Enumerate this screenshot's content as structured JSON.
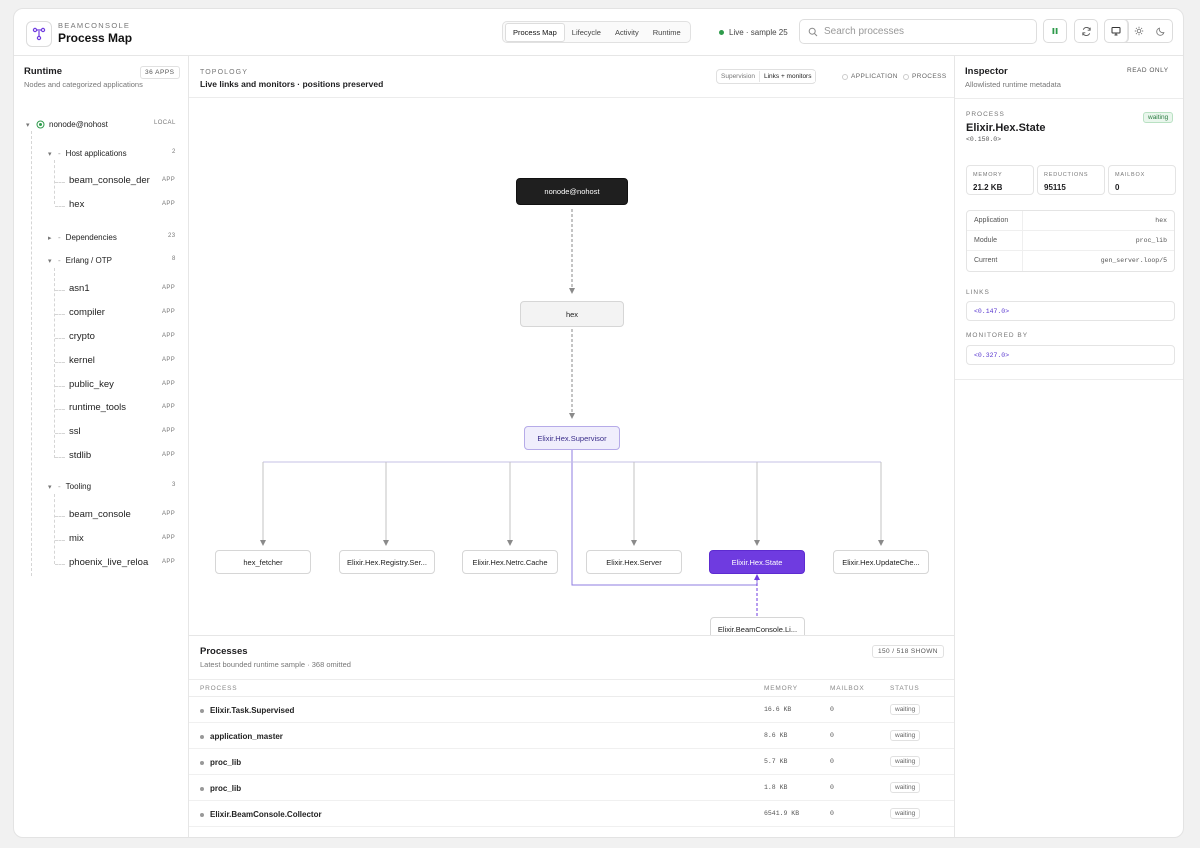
{
  "header": {
    "brand_small": "BEAMCONSOLE",
    "brand_title": "Process Map",
    "tabs": [
      "Process Map",
      "Lifecycle",
      "Activity",
      "Runtime"
    ],
    "live_text": "Live · sample 25",
    "search_placeholder": "Search processes",
    "colors": {
      "live": "#2e9b4b",
      "accent": "#6f3be0"
    }
  },
  "sidebar": {
    "title": "Runtime",
    "subtitle": "Nodes and categorized applications",
    "badge": "36 APPS",
    "node": {
      "name": "nonode@nohost",
      "tag": "LOCAL"
    },
    "groups": [
      {
        "label": "Host applications",
        "count": "2",
        "expanded": true,
        "apps": [
          "beam_console_der",
          "hex"
        ]
      },
      {
        "label": "Dependencies",
        "count": "23",
        "expanded": false,
        "apps": []
      },
      {
        "label": "Erlang / OTP",
        "count": "8",
        "expanded": true,
        "apps": [
          "asn1",
          "compiler",
          "crypto",
          "kernel",
          "public_key",
          "runtime_tools",
          "ssl",
          "stdlib"
        ]
      },
      {
        "label": "Tooling",
        "count": "3",
        "expanded": true,
        "apps": [
          "beam_console",
          "mix",
          "phoenix_live_reloa"
        ]
      }
    ],
    "app_tag": "APP"
  },
  "topology": {
    "kicker": "TOPOLOGY",
    "title": "Live links and monitors · positions preserved",
    "segments": [
      "Supervision",
      "Links + monitors"
    ],
    "legend": [
      "APPLICATION",
      "PROCESS"
    ],
    "nodes": {
      "root": "nonode@nohost",
      "app": "hex",
      "sup": "Elixir.Hex.Supervisor",
      "children": [
        "hex_fetcher",
        "Elixir.Hex.Registry.Ser...",
        "Elixir.Hex.Netrc.Cache",
        "Elixir.Hex.Server",
        "Elixir.Hex.State",
        "Elixir.Hex.UpdateChe..."
      ],
      "monitor": "Elixir.BeamConsole.Li..."
    }
  },
  "processes": {
    "title": "Processes",
    "subtitle": "Latest bounded runtime sample · 368 omitted",
    "badge": "150 / 518 SHOWN",
    "columns": [
      "PROCESS",
      "MEMORY",
      "MAILBOX",
      "STATUS"
    ],
    "rows": [
      {
        "name": "Elixir.Task.Supervised",
        "memory": "16.6 KB",
        "mailbox": "0",
        "status": "waiting"
      },
      {
        "name": "application_master",
        "memory": "8.6 KB",
        "mailbox": "0",
        "status": "waiting"
      },
      {
        "name": "proc_lib",
        "memory": "5.7 KB",
        "mailbox": "0",
        "status": "waiting"
      },
      {
        "name": "proc_lib",
        "memory": "1.8 KB",
        "mailbox": "0",
        "status": "waiting"
      },
      {
        "name": "Elixir.BeamConsole.Collector",
        "memory": "6541.9 KB",
        "mailbox": "0",
        "status": "waiting"
      }
    ]
  },
  "inspector": {
    "title": "Inspector",
    "subtitle": "Allowlisted runtime metadata",
    "readonly": "READ ONLY",
    "kicker": "PROCESS",
    "name": "Elixir.Hex.State",
    "pid": "<0.150.0>",
    "status": "waiting",
    "stats": [
      {
        "label": "MEMORY",
        "value": "21.2 KB"
      },
      {
        "label": "REDUCTIONS",
        "value": "95115"
      },
      {
        "label": "MAILBOX",
        "value": "0"
      }
    ],
    "meta": [
      {
        "key": "Application",
        "value": "hex"
      },
      {
        "key": "Module",
        "value": "proc_lib"
      },
      {
        "key": "Current",
        "value": "gen_server.loop/5"
      }
    ],
    "links_label": "LINKS",
    "links": "<0.147.0>",
    "monitored_label": "MONITORED BY",
    "monitored": "<0.327.0>"
  }
}
